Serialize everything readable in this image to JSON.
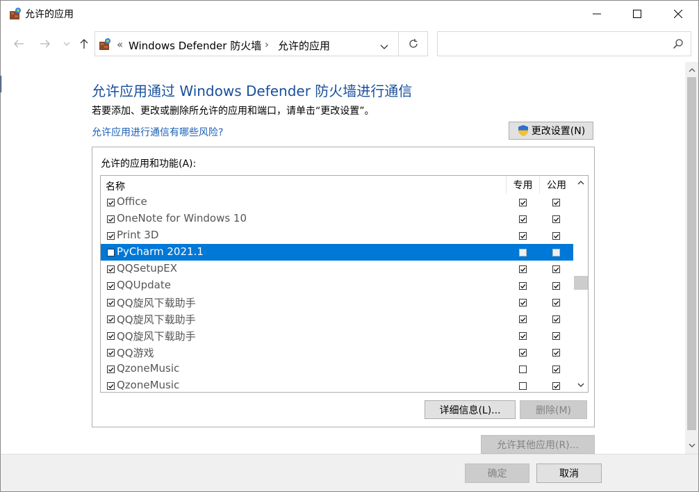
{
  "window": {
    "title": "允许的应用",
    "controls": {
      "minimize": "minimize",
      "maximize": "maximize",
      "close": "close"
    }
  },
  "nav": {
    "breadcrumb_prefix": "«",
    "breadcrumb_1": "Windows Defender 防火墙",
    "breadcrumb_sep": "›",
    "breadcrumb_2": "允许的应用",
    "search_placeholder": ""
  },
  "main": {
    "title": "允许应用通过 Windows Defender 防火墙进行通信",
    "subtitle": "若要添加、更改或删除所允许的应用和端口，请单击“更改设置”。",
    "risk_link": "允许应用进行通信有哪些风险?",
    "change_settings_label": "更改设置(N)",
    "group_label": "允许的应用和功能(A):",
    "columns": {
      "name": "名称",
      "private": "专用",
      "public": "公用"
    },
    "rows": [
      {
        "name": "Office",
        "enabled": true,
        "private": true,
        "public": true,
        "selected": false
      },
      {
        "name": "OneNote for Windows 10",
        "enabled": true,
        "private": true,
        "public": true,
        "selected": false
      },
      {
        "name": "Print 3D",
        "enabled": true,
        "private": true,
        "public": true,
        "selected": false
      },
      {
        "name": "PyCharm 2021.1",
        "enabled": false,
        "private": false,
        "public": false,
        "selected": true
      },
      {
        "name": "QQSetupEX",
        "enabled": true,
        "private": true,
        "public": true,
        "selected": false
      },
      {
        "name": "QQUpdate",
        "enabled": true,
        "private": true,
        "public": true,
        "selected": false
      },
      {
        "name": "QQ旋风下载助手",
        "enabled": true,
        "private": true,
        "public": true,
        "selected": false
      },
      {
        "name": "QQ旋风下载助手",
        "enabled": true,
        "private": true,
        "public": true,
        "selected": false
      },
      {
        "name": "QQ旋风下载助手",
        "enabled": true,
        "private": true,
        "public": true,
        "selected": false
      },
      {
        "name": "QQ游戏",
        "enabled": true,
        "private": true,
        "public": true,
        "selected": false
      },
      {
        "name": "QzoneMusic",
        "enabled": true,
        "private": false,
        "public": true,
        "selected": false
      },
      {
        "name": "QzoneMusic",
        "enabled": true,
        "private": false,
        "public": true,
        "selected": false
      }
    ],
    "details_label": "详细信息(L)...",
    "delete_label": "删除(M)",
    "allow_other_label": "允许其他应用(R)..."
  },
  "footer": {
    "ok_label": "确定",
    "cancel_label": "取消"
  },
  "colors": {
    "title_blue": "#1a4f9c",
    "link_blue": "#1a5fb4",
    "selection": "#0078d7"
  }
}
